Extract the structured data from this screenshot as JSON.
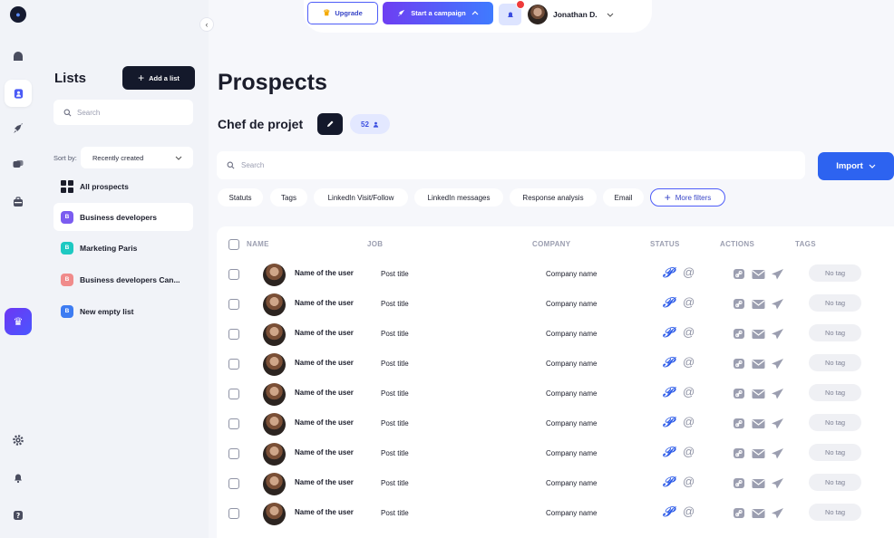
{
  "topbar": {
    "upgrade": "Upgrade",
    "campaign": "Start a campaign",
    "user": "Jonathan D."
  },
  "sidebar": {
    "title": "Lists",
    "add_list": "Add a list",
    "search_placeholder": "Search",
    "sort_by": "Sort by:",
    "sort_value": "Recently created",
    "items": [
      {
        "label": "All prospects",
        "icon": "grid-icon"
      },
      {
        "label": "Business developers",
        "badge": "B",
        "color": "#7b5cf0"
      },
      {
        "label": "Marketing Paris",
        "badge": "B",
        "color": "#1ec9c2"
      },
      {
        "label": "Business developers Can...",
        "badge": "B",
        "color": "#f08b8b"
      },
      {
        "label": "New empty list",
        "badge": "B",
        "color": "#3d7cf2"
      }
    ]
  },
  "main": {
    "title": "Prospects",
    "list_name": "Chef de projet",
    "count": "52",
    "search_placeholder": "Search",
    "import": "Import",
    "filters": [
      "Statuts",
      "Tags",
      "LinkedIn Visit/Follow",
      "LinkedIn messages",
      "Response analysis",
      "Email",
      "More filters"
    ],
    "columns": [
      "NAME",
      "JOB",
      "COMPANY",
      "STATUS",
      "ACTIONS",
      "TAGS"
    ],
    "rows": [
      {
        "name": "Name of the user",
        "job": "Post title",
        "company": "Company name",
        "tag": "No tag"
      },
      {
        "name": "Name of the user",
        "job": "Post title",
        "company": "Company name",
        "tag": "No tag"
      },
      {
        "name": "Name of the user",
        "job": "Post title",
        "company": "Company name",
        "tag": "No tag"
      },
      {
        "name": "Name of the user",
        "job": "Post title",
        "company": "Company name",
        "tag": "No tag"
      },
      {
        "name": "Name of the user",
        "job": "Post title",
        "company": "Company name",
        "tag": "No tag"
      },
      {
        "name": "Name of the user",
        "job": "Post title",
        "company": "Company name",
        "tag": "No tag"
      },
      {
        "name": "Name of the user",
        "job": "Post title",
        "company": "Company name",
        "tag": "No tag"
      },
      {
        "name": "Name of the user",
        "job": "Post title",
        "company": "Company name",
        "tag": "No tag"
      },
      {
        "name": "Name of the user",
        "job": "Post title",
        "company": "Company name",
        "tag": "No tag"
      }
    ]
  }
}
